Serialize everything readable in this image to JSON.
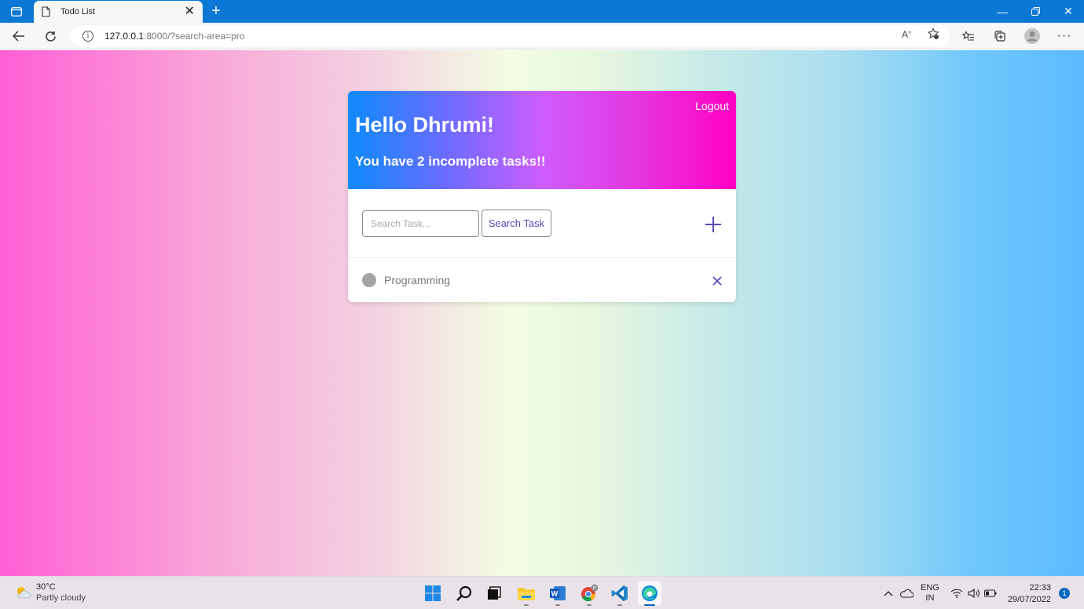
{
  "browser": {
    "tab_title": "Todo List",
    "url_host": "127.0.0.1",
    "url_rest": ":8000/?search-area=pro"
  },
  "page": {
    "logout_label": "Logout",
    "greeting": "Hello Dhrumi!",
    "incomplete_text": "You have 2 incomplete tasks!!",
    "search_placeholder": "Search Task...",
    "search_value": "",
    "search_button": "Search Task",
    "tasks": [
      {
        "title": "Programming",
        "complete": false
      }
    ]
  },
  "colors": {
    "header_gradient_start": "#0f8afb",
    "header_gradient_end": "#ff00c2",
    "accent": "#5b47b8"
  },
  "taskbar": {
    "weather_temp": "30°C",
    "weather_condition": "Partly cloudy",
    "lang_top": "ENG",
    "lang_bottom": "IN",
    "time": "22:33",
    "date": "29/07/2022",
    "notifications": "1"
  }
}
